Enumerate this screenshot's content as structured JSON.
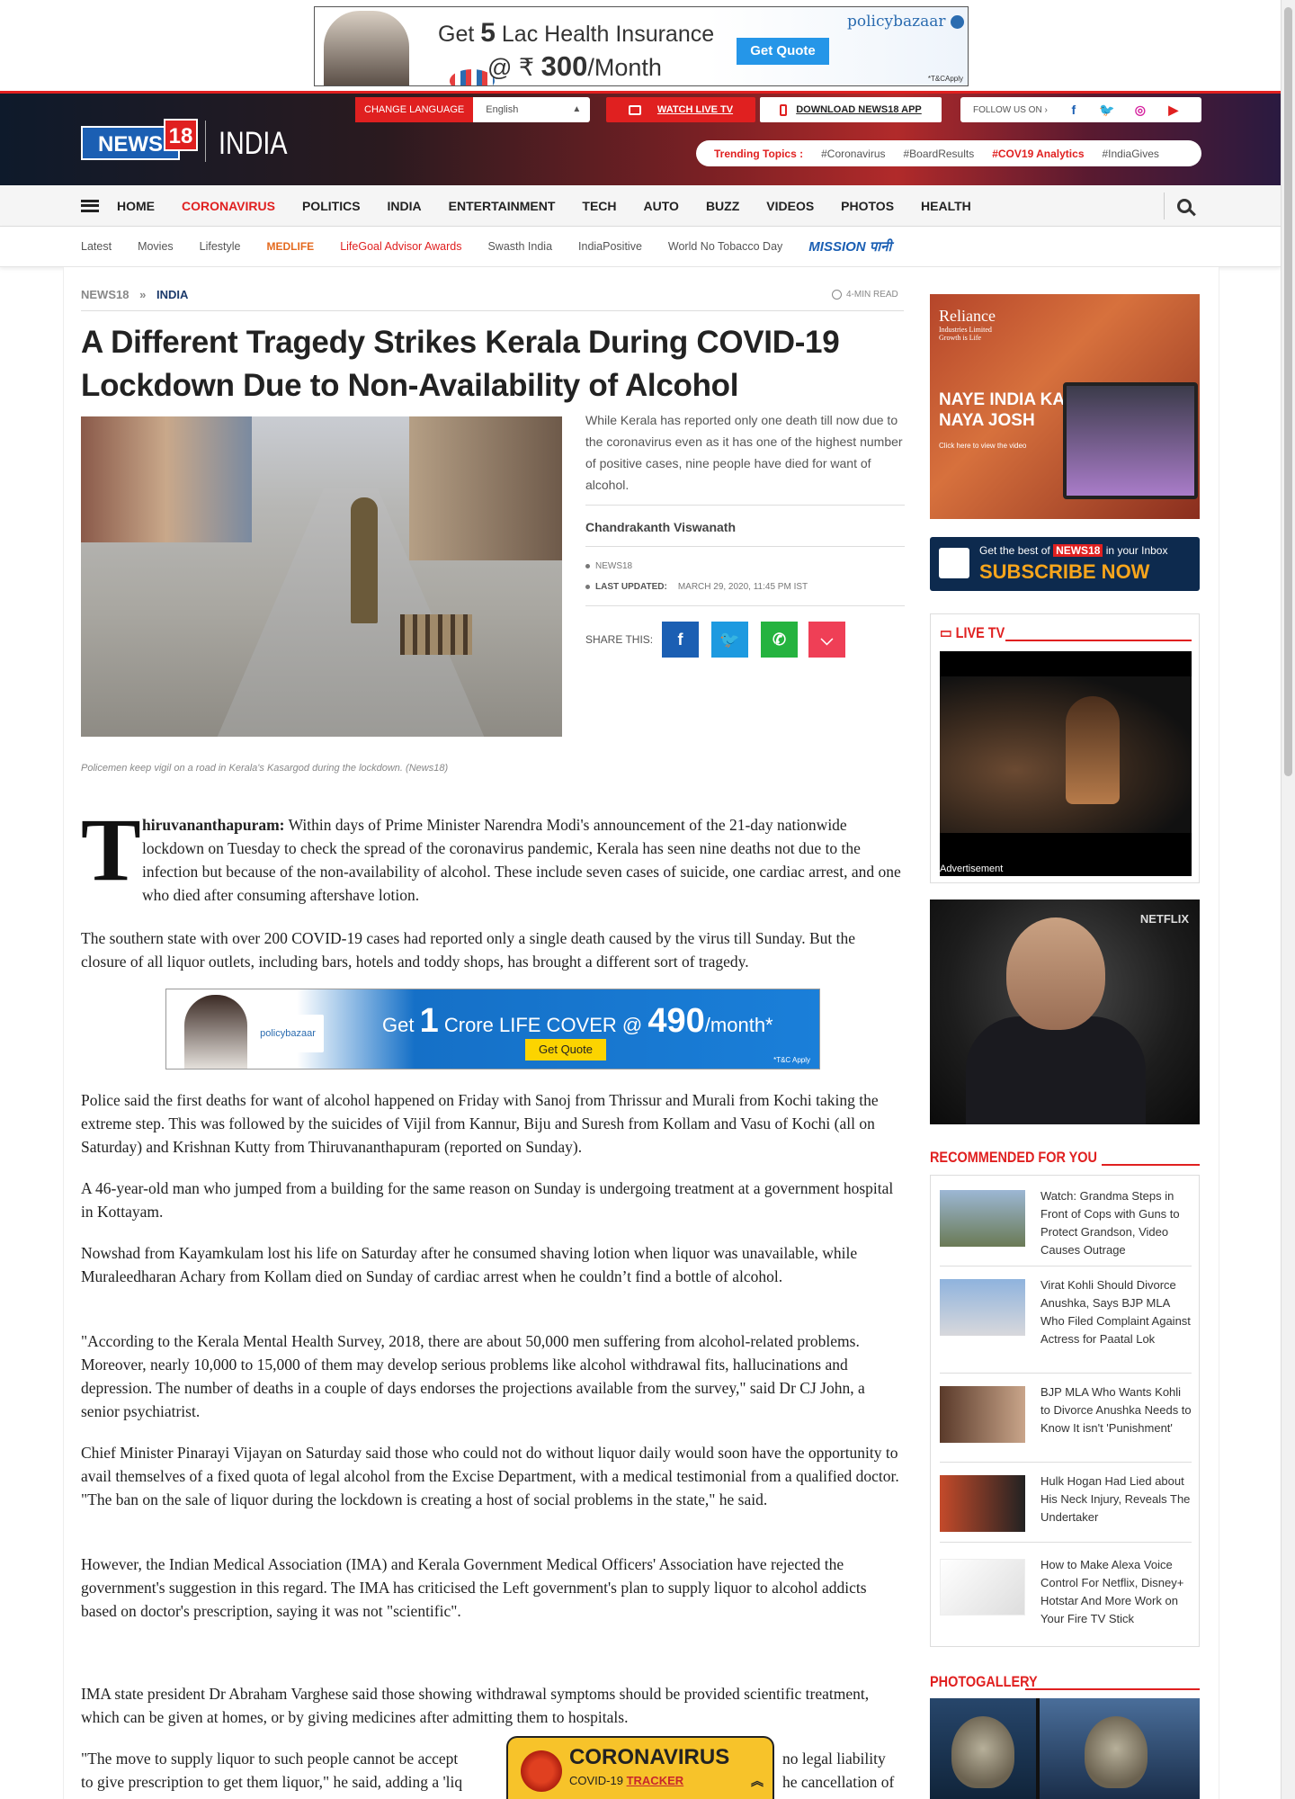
{
  "top_ad": {
    "line1_pre": "Get",
    "line1_num": "5",
    "line1_post": "Lac Health Insurance",
    "line2_pre": "@ ₹",
    "line2_num": "300",
    "line2_post": "/Month",
    "brand": "policybazaar",
    "cta": "Get Quote",
    "tc": "*T&CApply"
  },
  "header": {
    "logo_news": "NEWS",
    "logo_18": "18",
    "edition": "INDIA",
    "change_language": "CHANGE LANGUAGE",
    "language_value": "English",
    "watch_live": "WATCH LIVE TV",
    "download_app": "DOWNLOAD NEWS18 APP",
    "follow_us": "FOLLOW US ON",
    "trending_label": "Trending Topics :",
    "trending": [
      {
        "label": "#Coronavirus",
        "highlight": false
      },
      {
        "label": "#BoardResults",
        "highlight": false
      },
      {
        "label": "#COV19 Analytics",
        "highlight": true
      },
      {
        "label": "#IndiaGives",
        "highlight": false
      }
    ]
  },
  "nav": {
    "items": [
      "HOME",
      "CORONAVIRUS",
      "POLITICS",
      "INDIA",
      "ENTERTAINMENT",
      "TECH",
      "AUTO",
      "BUZZ",
      "VIDEOS",
      "PHOTOS",
      "HEALTH"
    ],
    "active": "CORONAVIRUS"
  },
  "subnav": {
    "items": [
      "Latest",
      "Movies",
      "Lifestyle"
    ],
    "medlife": "MEDLIFE",
    "lifegoal": "LifeGoal Advisor Awards",
    "items2": [
      "Swasth India",
      "IndiaPositive",
      "World No Tobacco Day"
    ],
    "mission": "MISSION पानी"
  },
  "article": {
    "crumb1": "NEWS18",
    "crumb_sep": "»",
    "crumb2": "INDIA",
    "read_time": "4-MIN READ",
    "headline": "A Different Tragedy Strikes Kerala During COVID-19 Lockdown Due to Non-Availability of Alcohol",
    "summary": "While Kerala has reported only one death till now due to the coronavirus even as it has one of the highest number of positive cases, nine people have died for want of alcohol.",
    "author": "Chandrakanth Viswanath",
    "source": "NEWS18",
    "last_updated_label": "LAST UPDATED:",
    "last_updated": "MARCH 29, 2020, 11:45 PM IST",
    "share_label": "SHARE THIS:",
    "caption": "Policemen keep vigil on a road in Kerala's Kasargod during the lockdown. (News18)",
    "dropcap": "T",
    "p1_lead": "hiruvananthapuram:",
    "p1": "Within days of Prime Minister Narendra Modi's announcement of the 21-day nationwide lockdown on Tuesday to check the spread of the coronavirus pandemic, Kerala has seen nine deaths not due to the infection but because of the non-availability of alcohol. These include seven cases of suicide, one cardiac arrest, and one who died after consuming aftershave lotion.",
    "p2": "The southern state with over 200 COVID-19 cases had reported only a single death caused by the virus till Sunday. But the closure of all liquor outlets, including bars, hotels and toddy shops, has brought a different sort of tragedy.",
    "p3": "Police said the first deaths for want of alcohol happened on Friday with Sanoj from Thrissur and Murali from Kochi taking the extreme step. This was followed by the suicides of Vijil from Kannur, Biju and Suresh from Kollam and Vasu of Kochi (all on Saturday) and Krishnan Kutty from Thiruvananthapuram (reported on Sunday).",
    "p4": "A 46-year-old man who jumped from a building for the same reason on Sunday is undergoing treatment at a government hospital in Kottayam.",
    "p5": "Nowshad from Kayamkulam lost his life on Saturday after he consumed shaving lotion when liquor was unavailable, while Muraleedharan Achary from Kollam died on Sunday of cardiac arrest when he couldn’t find a bottle of alcohol.",
    "p6": "\"According to the Kerala Mental Health Survey, 2018, there are about 50,000 men suffering from alcohol-related problems. Moreover, nearly 10,000 to 15,000 of them may develop serious problems like alcohol withdrawal fits, hallucinations and depression. The number of deaths in a couple of days endorses the projections available from the survey,\" said Dr CJ John, a senior psychiatrist.",
    "p7": "Chief Minister Pinarayi Vijayan on Saturday said those who could not do without liquor daily would soon have the opportunity to avail themselves of a fixed quota of legal alcohol from the Excise Department, with a medical testimonial from a qualified doctor. \"The ban on the sale of liquor during the lockdown is creating a host of social problems in the state,\" he said.",
    "p8": "However, the Indian Medical Association (IMA) and Kerala Government Medical Officers' Association have rejected the government's suggestion in this regard. The IMA has criticised the Left government's plan to supply liquor to alcohol addicts based on doctor's prescription, saying it was not \"scientific\".",
    "p9": "IMA state president Dr Abraham Varghese said those showing withdrawal symptoms should be provided scientific treatment, which can be given at homes, or by giving medicines after admitting them to hospitals.",
    "p10a": "\"The move to supply liquor to such people cannot be accept",
    "p10b": "no legal liability",
    "p10c": "to give prescription to get them liquor,\" he said, adding a 'liq",
    "p10d": "he cancellation of"
  },
  "mid_ad": {
    "brand": "policybazaar",
    "get": "Get",
    "num": "1",
    "crore": "Crore LIFE COVER",
    "at": "@",
    "price": "490",
    "per": "/month*",
    "cta": "Get Quote",
    "tc": "*T&C Apply"
  },
  "sidebar": {
    "reliance_brand": "Reliance",
    "reliance_sub": "Industries Limited",
    "reliance_tag": "Growth is Life",
    "reliance_head1": "NAYE INDIA KA",
    "reliance_head2": "NAYA JOSH",
    "reliance_click": "Click here to view the video",
    "sub_line1_pre": "Get the best of",
    "sub_line1_brand": "NEWS18",
    "sub_line1_post": "in your Inbox",
    "sub_line2": "SUBSCRIBE NOW",
    "live_tv": "LIVE TV",
    "advertisement": "Advertisement",
    "netflix": "NETFLIX",
    "recommended": "RECOMMENDED FOR YOU",
    "reco": [
      "Watch: Grandma Steps in Front of Cops with Guns to Protect Grandson, Video Causes Outrage",
      "Virat Kohli Should Divorce Anushka, Says BJP MLA Who Filed Complaint Against Actress for Paatal Lok",
      "BJP MLA Who Wants Kohli to Divorce Anushka Needs to Know It isn't 'Punishment'",
      "Hulk Hogan Had Lied about His Neck Injury, Reveals The Undertaker",
      "How to Make Alexa Voice Control For Netflix, Disney+ Hotstar And More Work on Your Fire TV Stick"
    ],
    "photogallery": "PHOTOGALLERY"
  },
  "covid": {
    "title": "CORONAVIRUS",
    "sub_pre": "COVID-19",
    "sub_link": "TRACKER"
  },
  "colors": {
    "accent_red": "#e02020",
    "facebook": "#1b5fb3",
    "twitter": "#1d9ae0",
    "whatsapp": "#25b33f",
    "pocket": "#ef3f56"
  }
}
